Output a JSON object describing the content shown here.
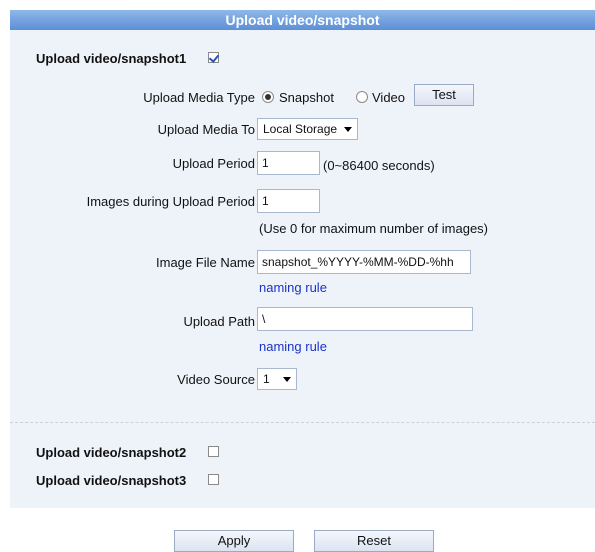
{
  "header": {
    "title": "Upload video/snapshot"
  },
  "snapshot1": {
    "label": "Upload video/snapshot1",
    "checked": true
  },
  "media_type": {
    "label": "Upload Media Type",
    "options": [
      "Snapshot",
      "Video"
    ],
    "selected": "Snapshot",
    "test_label": "Test"
  },
  "media_to": {
    "label": "Upload Media To",
    "value": "Local Storage"
  },
  "period": {
    "label": "Upload Period",
    "value": "1",
    "hint": "(0~86400 seconds)"
  },
  "images": {
    "label": "Images during Upload Period",
    "value": "1",
    "hint": "(Use 0 for maximum number of images)"
  },
  "file_name": {
    "label": "Image File Name",
    "value": "snapshot_%YYYY-%MM-%DD-%hh",
    "link": "naming rule"
  },
  "path": {
    "label": "Upload Path",
    "value": "\\",
    "link": "naming rule"
  },
  "video_source": {
    "label": "Video Source",
    "value": "1"
  },
  "snapshot2": {
    "label": "Upload video/snapshot2",
    "checked": false
  },
  "snapshot3": {
    "label": "Upload video/snapshot3",
    "checked": false
  },
  "actions": {
    "apply": "Apply",
    "reset": "Reset"
  }
}
